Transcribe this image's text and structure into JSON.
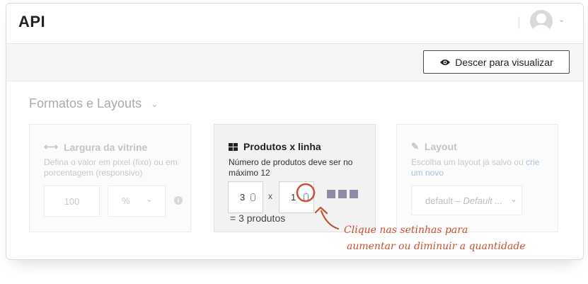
{
  "header": {
    "title": "API"
  },
  "toolbar": {
    "view_button": "Descer para visualizar",
    "view_icon": "eye-icon"
  },
  "section": {
    "title": "Formatos e Layouts"
  },
  "panels": {
    "width": {
      "title": "Largura da vitrine",
      "description": "Defina o valor em pixel (fixo) ou em porcentagem (responsivo)",
      "value": "100",
      "unit": "%"
    },
    "products": {
      "title": "Produtos x linha",
      "description": "Número de produtos deve ser no máximo 12",
      "columns": "3",
      "times": "x",
      "rows": "1",
      "total": "= 3 produtos"
    },
    "layout": {
      "title": "Layout",
      "description": "Escolha um layout já salvo ou ",
      "link": "crie um novo",
      "select_default": "default",
      "select_dash": "–",
      "select_name": "Default ..."
    }
  },
  "annotation": {
    "line1": "Clique nas setinhas para",
    "line2": "aumentar ou diminuir a quantidade"
  },
  "colors": {
    "accent": "#c9502f",
    "squares": "#8f8aa6"
  }
}
